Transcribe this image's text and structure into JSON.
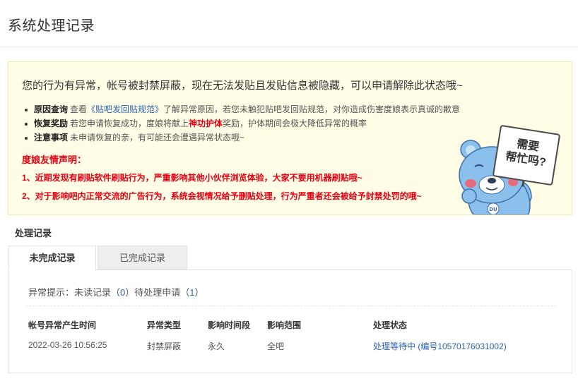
{
  "header": {
    "title": "系统处理记录"
  },
  "notice": {
    "headline": "您的行为有异常，帐号被封禁屏蔽，现在无法发贴且发贴信息被隐藏，可以申请解除此状态哦~",
    "reasons": [
      {
        "label": "原因查询",
        "pre": "查看",
        "link": "《贴吧发回贴规范》",
        "post": "了解异常原因，若您未触犯贴吧发回贴规范，对你造成伤害度娘表示真诚的歉意"
      },
      {
        "label": "恢复奖励",
        "pre": "若您申请恢复成功，度娘将献上",
        "highlight": "神功护体",
        "post": "奖励，护体期间会极大降低异常的概率"
      },
      {
        "label": "注意事项",
        "text": "未申请恢复的亲，有可能还会遭遇异常状态哦~"
      }
    ],
    "declaration_title": "度娘友情声明：",
    "declarations": [
      "1、近期发现有刷贴软件刷贴行为，严重影响其他小伙伴浏览体验，大家不要用机器刷贴哦~",
      "2、对于影响吧内正常交流的广告行为，系统会视情况给予删贴处理，行为严重者还会被给予封禁处罚的哦~"
    ],
    "mascot_sign": {
      "line1": "需要",
      "line2": "帮忙吗?"
    }
  },
  "records": {
    "section_title": "处理记录",
    "tabs": [
      {
        "label": "未完成记录"
      },
      {
        "label": "已完成记录"
      }
    ],
    "hint": {
      "prefix": "异常提示：未读记录（",
      "unread": "0",
      "middle": "）待处理申请（",
      "pending": "1",
      "suffix": "）"
    },
    "columns": [
      "帐号异常产生时间",
      "异常类型",
      "影响时间段",
      "影响范围",
      "处理状态"
    ],
    "rows": [
      {
        "time": "2022-03-26 10:56:25",
        "type": "封禁屏蔽",
        "duration": "永久",
        "scope": "全吧",
        "status": "处理等待中 (编号10570176031002)"
      }
    ]
  },
  "colors": {
    "notice_bg": "#fffde6",
    "warning_red": "#e60012",
    "link_blue": "#2b62b6",
    "mascot_blue": "#8cc0ec"
  }
}
